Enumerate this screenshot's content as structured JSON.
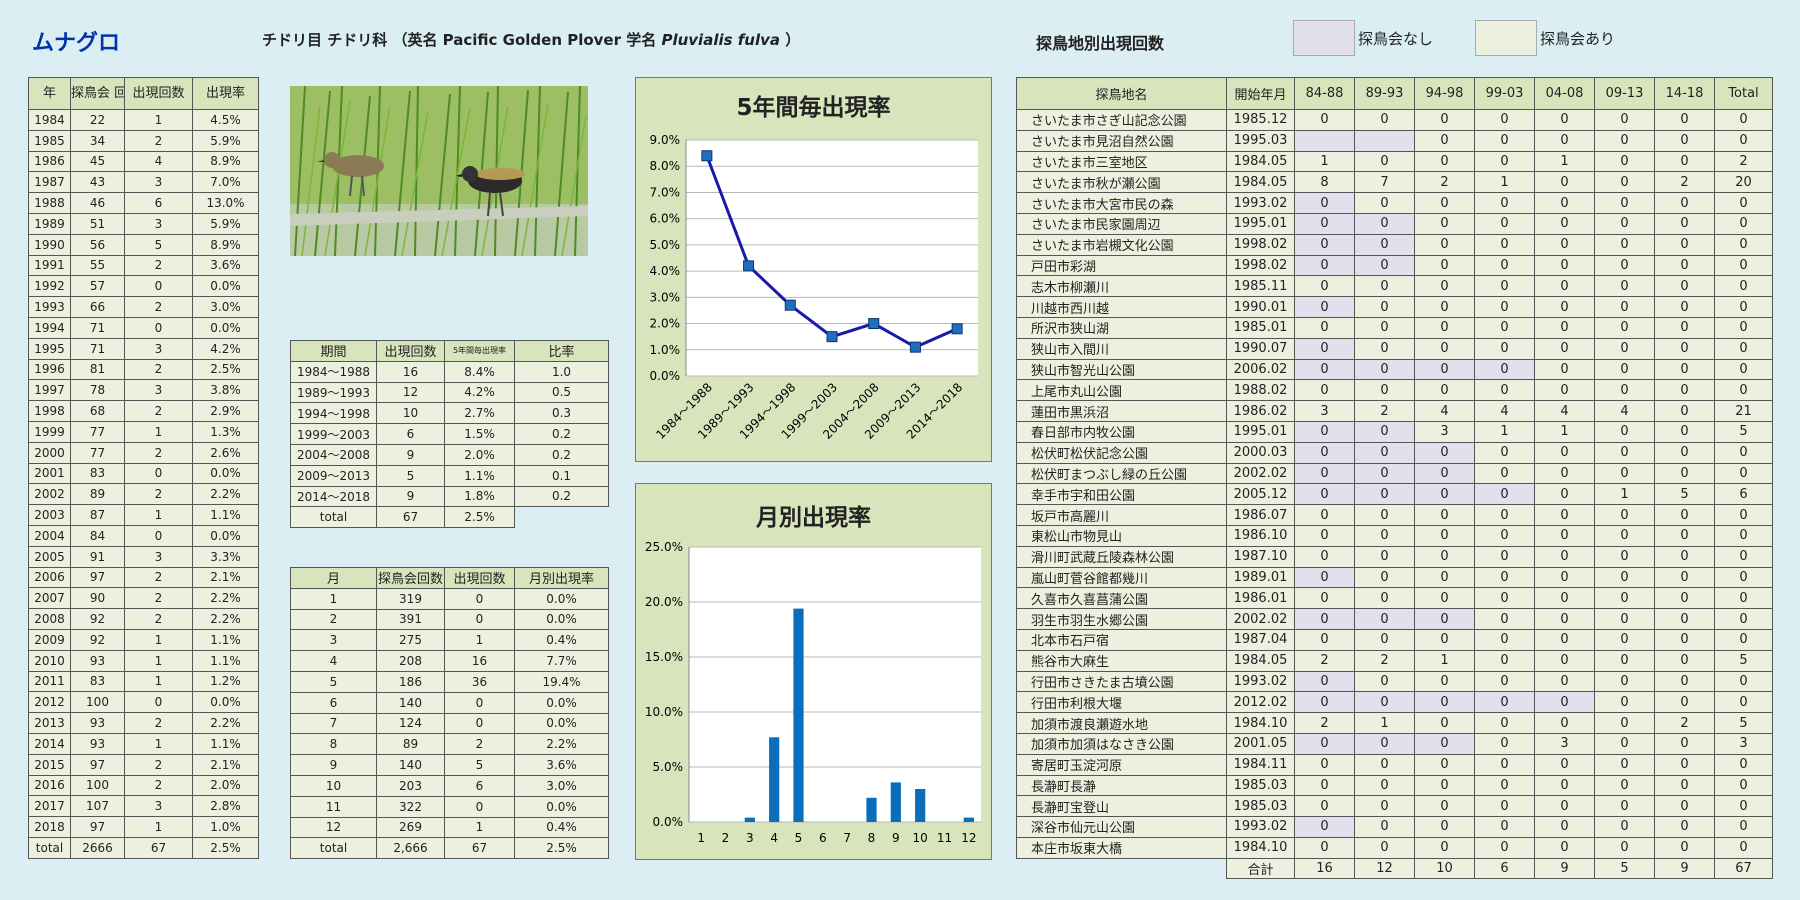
{
  "header": {
    "species": "ムナグロ",
    "taxon": "チドリ目 チドリ科 （英名 Pacific Golden Plover 学名",
    "sci_name": "Pluvialis fulva",
    "close": "）"
  },
  "site_title": "探鳥地別出現回数",
  "legend": {
    "none_label": "探鳥会なし",
    "none_color": "#e4dfec",
    "some_label": "探鳥会あり",
    "some_color": "#ebf1de"
  },
  "yearly": {
    "headers": [
      "年",
      "探鳥会\n回数",
      "出現回数",
      "出現率"
    ],
    "rows": [
      [
        "1984",
        "22",
        "1",
        "4.5%"
      ],
      [
        "1985",
        "34",
        "2",
        "5.9%"
      ],
      [
        "1986",
        "45",
        "4",
        "8.9%"
      ],
      [
        "1987",
        "43",
        "3",
        "7.0%"
      ],
      [
        "1988",
        "46",
        "6",
        "13.0%"
      ],
      [
        "1989",
        "51",
        "3",
        "5.9%"
      ],
      [
        "1990",
        "56",
        "5",
        "8.9%"
      ],
      [
        "1991",
        "55",
        "2",
        "3.6%"
      ],
      [
        "1992",
        "57",
        "0",
        "0.0%"
      ],
      [
        "1993",
        "66",
        "2",
        "3.0%"
      ],
      [
        "1994",
        "71",
        "0",
        "0.0%"
      ],
      [
        "1995",
        "71",
        "3",
        "4.2%"
      ],
      [
        "1996",
        "81",
        "2",
        "2.5%"
      ],
      [
        "1997",
        "78",
        "3",
        "3.8%"
      ],
      [
        "1998",
        "68",
        "2",
        "2.9%"
      ],
      [
        "1999",
        "77",
        "1",
        "1.3%"
      ],
      [
        "2000",
        "77",
        "2",
        "2.6%"
      ],
      [
        "2001",
        "83",
        "0",
        "0.0%"
      ],
      [
        "2002",
        "89",
        "2",
        "2.2%"
      ],
      [
        "2003",
        "87",
        "1",
        "1.1%"
      ],
      [
        "2004",
        "84",
        "0",
        "0.0%"
      ],
      [
        "2005",
        "91",
        "3",
        "3.3%"
      ],
      [
        "2006",
        "97",
        "2",
        "2.1%"
      ],
      [
        "2007",
        "90",
        "2",
        "2.2%"
      ],
      [
        "2008",
        "92",
        "2",
        "2.2%"
      ],
      [
        "2009",
        "92",
        "1",
        "1.1%"
      ],
      [
        "2010",
        "93",
        "1",
        "1.1%"
      ],
      [
        "2011",
        "83",
        "1",
        "1.2%"
      ],
      [
        "2012",
        "100",
        "0",
        "0.0%"
      ],
      [
        "2013",
        "93",
        "2",
        "2.2%"
      ],
      [
        "2014",
        "93",
        "1",
        "1.1%"
      ],
      [
        "2015",
        "97",
        "2",
        "2.1%"
      ],
      [
        "2016",
        "100",
        "2",
        "2.0%"
      ],
      [
        "2017",
        "107",
        "3",
        "2.8%"
      ],
      [
        "2018",
        "97",
        "1",
        "1.0%"
      ],
      [
        "total",
        "2666",
        "67",
        "2.5%"
      ]
    ]
  },
  "periods": {
    "headers": [
      "期間",
      "出現回数",
      "5年間毎出現率",
      "比率"
    ],
    "rows": [
      [
        "1984～1988",
        "16",
        "8.4%",
        "1.0"
      ],
      [
        "1989～1993",
        "12",
        "4.2%",
        "0.5"
      ],
      [
        "1994～1998",
        "10",
        "2.7%",
        "0.3"
      ],
      [
        "1999～2003",
        "6",
        "1.5%",
        "0.2"
      ],
      [
        "2004～2008",
        "9",
        "2.0%",
        "0.2"
      ],
      [
        "2009～2013",
        "5",
        "1.1%",
        "0.1"
      ],
      [
        "2014～2018",
        "9",
        "1.8%",
        "0.2"
      ]
    ],
    "total": [
      "total",
      "67",
      "2.5%"
    ]
  },
  "monthly": {
    "headers": [
      "月",
      "探鳥会回数",
      "出現回数",
      "月別出現率"
    ],
    "rows": [
      [
        "1",
        "319",
        "0",
        "0.0%"
      ],
      [
        "2",
        "391",
        "0",
        "0.0%"
      ],
      [
        "3",
        "275",
        "1",
        "0.4%"
      ],
      [
        "4",
        "208",
        "16",
        "7.7%"
      ],
      [
        "5",
        "186",
        "36",
        "19.4%"
      ],
      [
        "6",
        "140",
        "0",
        "0.0%"
      ],
      [
        "7",
        "124",
        "0",
        "0.0%"
      ],
      [
        "8",
        "89",
        "2",
        "2.2%"
      ],
      [
        "9",
        "140",
        "5",
        "3.6%"
      ],
      [
        "10",
        "203",
        "6",
        "3.0%"
      ],
      [
        "11",
        "322",
        "0",
        "0.0%"
      ],
      [
        "12",
        "269",
        "1",
        "0.4%"
      ],
      [
        "total",
        "2,666",
        "67",
        "2.5%"
      ]
    ]
  },
  "sites": {
    "headers": [
      "探鳥地名",
      "開始年月",
      "84-88",
      "89-93",
      "94-98",
      "99-03",
      "04-08",
      "09-13",
      "14-18",
      "Total"
    ],
    "rows": [
      {
        "name": "さいたま市さぎ山記念公園",
        "start": "1985.12",
        "v": [
          "0",
          "0",
          "0",
          "0",
          "0",
          "0",
          "0",
          "0"
        ],
        "none": []
      },
      {
        "name": "さいたま市見沼自然公園",
        "start": "1995.03",
        "v": [
          "",
          "",
          "0",
          "0",
          "0",
          "0",
          "0",
          "0"
        ],
        "none": [
          0,
          1
        ]
      },
      {
        "name": "さいたま市三室地区",
        "start": "1984.05",
        "v": [
          "1",
          "0",
          "0",
          "0",
          "1",
          "0",
          "0",
          "2"
        ],
        "none": []
      },
      {
        "name": "さいたま市秋が瀬公園",
        "start": "1984.05",
        "v": [
          "8",
          "7",
          "2",
          "1",
          "0",
          "0",
          "2",
          "20"
        ],
        "none": []
      },
      {
        "name": "さいたま市大宮市民の森",
        "start": "1993.02",
        "v": [
          "0",
          "0",
          "0",
          "0",
          "0",
          "0",
          "0",
          "0"
        ],
        "none": [
          0
        ]
      },
      {
        "name": "さいたま市民家園周辺",
        "start": "1995.01",
        "v": [
          "0",
          "0",
          "0",
          "0",
          "0",
          "0",
          "0",
          "0"
        ],
        "none": [
          0,
          1
        ]
      },
      {
        "name": "さいたま市岩槻文化公園",
        "start": "1998.02",
        "v": [
          "0",
          "0",
          "0",
          "0",
          "0",
          "0",
          "0",
          "0"
        ],
        "none": [
          0,
          1
        ]
      },
      {
        "name": "戸田市彩湖",
        "start": "1998.02",
        "v": [
          "0",
          "0",
          "0",
          "0",
          "0",
          "0",
          "0",
          "0"
        ],
        "none": [
          0,
          1
        ]
      },
      {
        "name": "志木市柳瀬川",
        "start": "1985.11",
        "v": [
          "0",
          "0",
          "0",
          "0",
          "0",
          "0",
          "0",
          "0"
        ],
        "none": []
      },
      {
        "name": "川越市西川越",
        "start": "1990.01",
        "v": [
          "0",
          "0",
          "0",
          "0",
          "0",
          "0",
          "0",
          "0"
        ],
        "none": [
          0
        ]
      },
      {
        "name": "所沢市狭山湖",
        "start": "1985.01",
        "v": [
          "0",
          "0",
          "0",
          "0",
          "0",
          "0",
          "0",
          "0"
        ],
        "none": []
      },
      {
        "name": "狭山市入間川",
        "start": "1990.07",
        "v": [
          "0",
          "0",
          "0",
          "0",
          "0",
          "0",
          "0",
          "0"
        ],
        "none": [
          0
        ]
      },
      {
        "name": "狭山市智光山公園",
        "start": "2006.02",
        "v": [
          "0",
          "0",
          "0",
          "0",
          "0",
          "0",
          "0",
          "0"
        ],
        "none": [
          0,
          1,
          2,
          3
        ]
      },
      {
        "name": "上尾市丸山公園",
        "start": "1988.02",
        "v": [
          "0",
          "0",
          "0",
          "0",
          "0",
          "0",
          "0",
          "0"
        ],
        "none": []
      },
      {
        "name": "蓮田市黒浜沼",
        "start": "1986.02",
        "v": [
          "3",
          "2",
          "4",
          "4",
          "4",
          "4",
          "0",
          "21"
        ],
        "none": []
      },
      {
        "name": "春日部市内牧公園",
        "start": "1995.01",
        "v": [
          "0",
          "0",
          "3",
          "1",
          "1",
          "0",
          "0",
          "5"
        ],
        "none": [
          0,
          1
        ]
      },
      {
        "name": "松伏町松伏記念公園",
        "start": "2000.03",
        "v": [
          "0",
          "0",
          "0",
          "0",
          "0",
          "0",
          "0",
          "0"
        ],
        "none": [
          0,
          1,
          2
        ]
      },
      {
        "name": "松伏町まつぶし緑の丘公園",
        "start": "2002.02",
        "v": [
          "0",
          "0",
          "0",
          "0",
          "0",
          "0",
          "0",
          "0"
        ],
        "none": [
          0,
          1,
          2
        ]
      },
      {
        "name": "幸手市宇和田公園",
        "start": "2005.12",
        "v": [
          "0",
          "0",
          "0",
          "0",
          "0",
          "1",
          "5",
          "6"
        ],
        "none": [
          0,
          1,
          2,
          3
        ]
      },
      {
        "name": "坂戸市高麗川",
        "start": "1986.07",
        "v": [
          "0",
          "0",
          "0",
          "0",
          "0",
          "0",
          "0",
          "0"
        ],
        "none": []
      },
      {
        "name": "東松山市物見山",
        "start": "1986.10",
        "v": [
          "0",
          "0",
          "0",
          "0",
          "0",
          "0",
          "0",
          "0"
        ],
        "none": []
      },
      {
        "name": "滑川町武蔵丘陵森林公園",
        "start": "1987.10",
        "v": [
          "0",
          "0",
          "0",
          "0",
          "0",
          "0",
          "0",
          "0"
        ],
        "none": []
      },
      {
        "name": "嵐山町菅谷館都幾川",
        "start": "1989.01",
        "v": [
          "0",
          "0",
          "0",
          "0",
          "0",
          "0",
          "0",
          "0"
        ],
        "none": [
          0
        ]
      },
      {
        "name": "久喜市久喜菖蒲公園",
        "start": "1986.01",
        "v": [
          "0",
          "0",
          "0",
          "0",
          "0",
          "0",
          "0",
          "0"
        ],
        "none": []
      },
      {
        "name": "羽生市羽生水郷公園",
        "start": "2002.02",
        "v": [
          "0",
          "0",
          "0",
          "0",
          "0",
          "0",
          "0",
          "0"
        ],
        "none": [
          0,
          1,
          2
        ]
      },
      {
        "name": "北本市石戸宿",
        "start": "1987.04",
        "v": [
          "0",
          "0",
          "0",
          "0",
          "0",
          "0",
          "0",
          "0"
        ],
        "none": []
      },
      {
        "name": "熊谷市大麻生",
        "start": "1984.05",
        "v": [
          "2",
          "2",
          "1",
          "0",
          "0",
          "0",
          "0",
          "5"
        ],
        "none": []
      },
      {
        "name": "行田市さきたま古墳公園",
        "start": "1993.02",
        "v": [
          "0",
          "0",
          "0",
          "0",
          "0",
          "0",
          "0",
          "0"
        ],
        "none": [
          0
        ]
      },
      {
        "name": "行田市利根大堰",
        "start": "2012.02",
        "v": [
          "0",
          "0",
          "0",
          "0",
          "0",
          "0",
          "0",
          "0"
        ],
        "none": [
          0,
          1,
          2,
          3,
          4
        ]
      },
      {
        "name": "加須市渡良瀬遊水地",
        "start": "1984.10",
        "v": [
          "2",
          "1",
          "0",
          "0",
          "0",
          "0",
          "2",
          "5"
        ],
        "none": []
      },
      {
        "name": "加須市加須はなさき公園",
        "start": "2001.05",
        "v": [
          "0",
          "0",
          "0",
          "0",
          "3",
          "0",
          "0",
          "3"
        ],
        "none": [
          0,
          1,
          2
        ]
      },
      {
        "name": "寄居町玉淀河原",
        "start": "1984.11",
        "v": [
          "0",
          "0",
          "0",
          "0",
          "0",
          "0",
          "0",
          "0"
        ],
        "none": []
      },
      {
        "name": "長瀞町長瀞",
        "start": "1985.03",
        "v": [
          "0",
          "0",
          "0",
          "0",
          "0",
          "0",
          "0",
          "0"
        ],
        "none": []
      },
      {
        "name": "長瀞町宝登山",
        "start": "1985.03",
        "v": [
          "0",
          "0",
          "0",
          "0",
          "0",
          "0",
          "0",
          "0"
        ],
        "none": []
      },
      {
        "name": "深谷市仙元山公園",
        "start": "1993.02",
        "v": [
          "0",
          "0",
          "0",
          "0",
          "0",
          "0",
          "0",
          "0"
        ],
        "none": [
          0
        ]
      },
      {
        "name": "本庄市坂東大橋",
        "start": "1984.10",
        "v": [
          "0",
          "0",
          "0",
          "0",
          "0",
          "0",
          "0",
          "0"
        ],
        "none": []
      }
    ],
    "total_label": "合計",
    "totals": [
      "16",
      "12",
      "10",
      "6",
      "9",
      "5",
      "9",
      "67"
    ]
  },
  "chart_data": [
    {
      "type": "line",
      "title": "5年間毎出現率",
      "categories": [
        "1984～1988",
        "1989～1993",
        "1994～1998",
        "1999～2003",
        "2004～2008",
        "2009～2013",
        "2014～2018"
      ],
      "values": [
        8.4,
        4.2,
        2.7,
        1.5,
        2.0,
        1.1,
        1.8
      ],
      "ylim": [
        0,
        9
      ],
      "yticks": [
        "0.0%",
        "1.0%",
        "2.0%",
        "3.0%",
        "4.0%",
        "5.0%",
        "6.0%",
        "7.0%",
        "8.0%",
        "9.0%"
      ],
      "color": "#1a1aaa",
      "marker_color": "#1f6fc0",
      "grid": true
    },
    {
      "type": "bar",
      "title": "月別出現率",
      "categories": [
        "1",
        "2",
        "3",
        "4",
        "5",
        "6",
        "7",
        "8",
        "9",
        "10",
        "11",
        "12"
      ],
      "values": [
        0.0,
        0.0,
        0.4,
        7.7,
        19.4,
        0.0,
        0.0,
        2.2,
        3.6,
        3.0,
        0.0,
        0.4
      ],
      "ylim": [
        0,
        25
      ],
      "yticks": [
        "0.0%",
        "5.0%",
        "10.0%",
        "15.0%",
        "20.0%",
        "25.0%"
      ],
      "color": "#0a6ebd",
      "grid": true
    }
  ]
}
